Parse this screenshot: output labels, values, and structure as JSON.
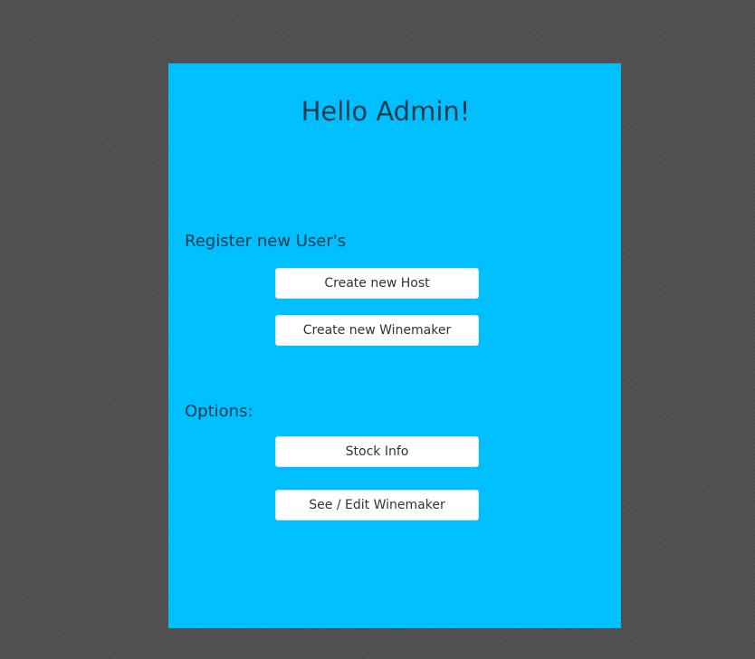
{
  "window": {
    "panel_color": "#00bfff",
    "background_color": "#4f4f4f"
  },
  "header": {
    "title": "Hello Admin!"
  },
  "register_section": {
    "label": "Register new User's",
    "buttons": [
      {
        "label": "Create new Host"
      },
      {
        "label": "Create new Winemaker"
      }
    ]
  },
  "options_section": {
    "label": "Options:",
    "buttons": [
      {
        "label": "Stock Info"
      },
      {
        "label": "See / Edit Winemaker"
      }
    ]
  }
}
